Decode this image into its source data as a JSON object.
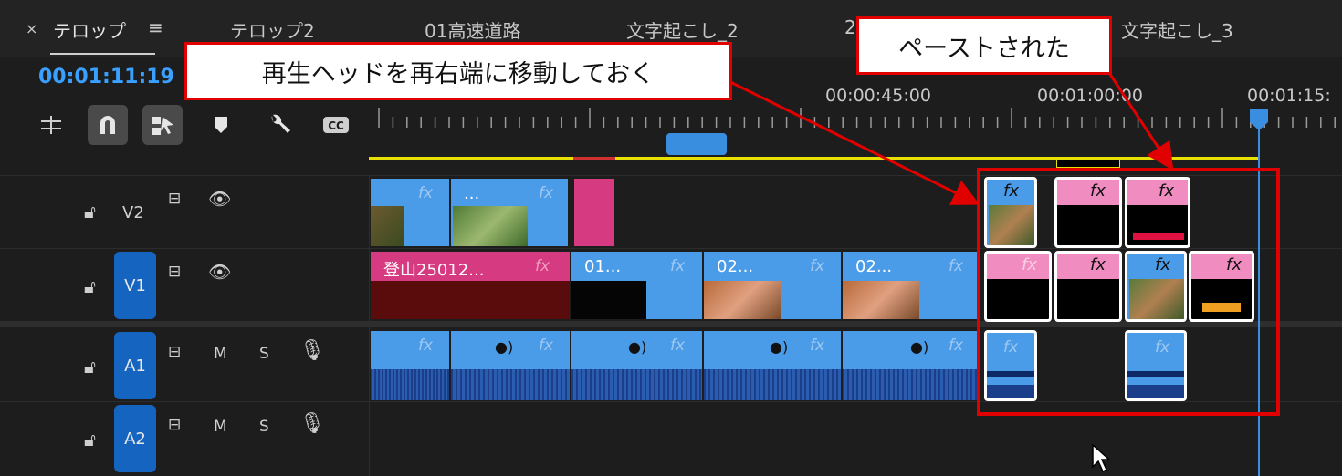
{
  "tabs": {
    "close": "×",
    "items": [
      "テロップ",
      "テロップ2",
      "01高速道路",
      "文字起こし_2",
      "2",
      "文字起こし_3"
    ],
    "menu": "≡"
  },
  "timecode": "00:01:11:19",
  "ruler": {
    "labels": [
      "00:00:45:00",
      "00:01:00:00",
      "00:01:15:"
    ]
  },
  "tracks": {
    "v2": "V2",
    "v1": "V1",
    "a1": "A1",
    "a2": "A2",
    "mute": "M",
    "solo": "S"
  },
  "clips": {
    "v2_clip2_label": "...",
    "v1_clip1_label": "登山25012...",
    "v1_clip2_label": "01...",
    "v1_clip3_label": "02...",
    "v1_clip4_label": "02...",
    "fx": "fx"
  },
  "callouts": {
    "playhead_note": "再生ヘッドを再右端に移動しておく",
    "pasted_note": "ペーストされた"
  },
  "colors": {
    "accent": "#3aa0ff",
    "clip_blue": "#4a9be8",
    "clip_pink": "#d63a80",
    "highlight_red": "#e00000",
    "work_area_yellow": "#e8e000"
  }
}
